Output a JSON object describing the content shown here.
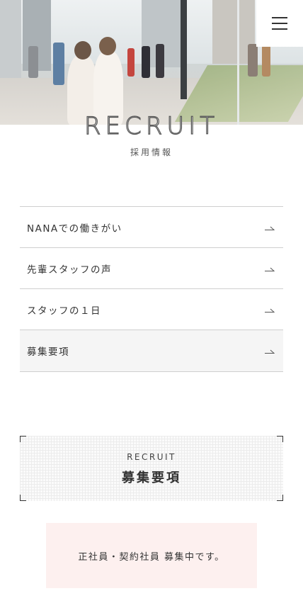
{
  "header": {
    "menu_icon": "hamburger-icon"
  },
  "hero": {
    "title": "RECRUIT",
    "subtitle": "採用情報"
  },
  "menu_list": {
    "items": [
      {
        "label": "NANAでの働きがい",
        "icon": "arrow-right-icon"
      },
      {
        "label": "先輩スタッフの声",
        "icon": "arrow-right-icon"
      },
      {
        "label": "スタッフの１日",
        "icon": "arrow-right-icon"
      },
      {
        "label": "募集要項",
        "icon": "arrow-right-icon",
        "active": true
      }
    ]
  },
  "recruit_section": {
    "label_en": "RECRUIT",
    "label_jp": "募集要項"
  },
  "notice": {
    "text": "正社員・契約社員 募集中です。"
  },
  "colors": {
    "notice_bg": "#fdf0ef",
    "active_row_bg": "#f5f5f5",
    "divider": "#cfcfcf"
  }
}
